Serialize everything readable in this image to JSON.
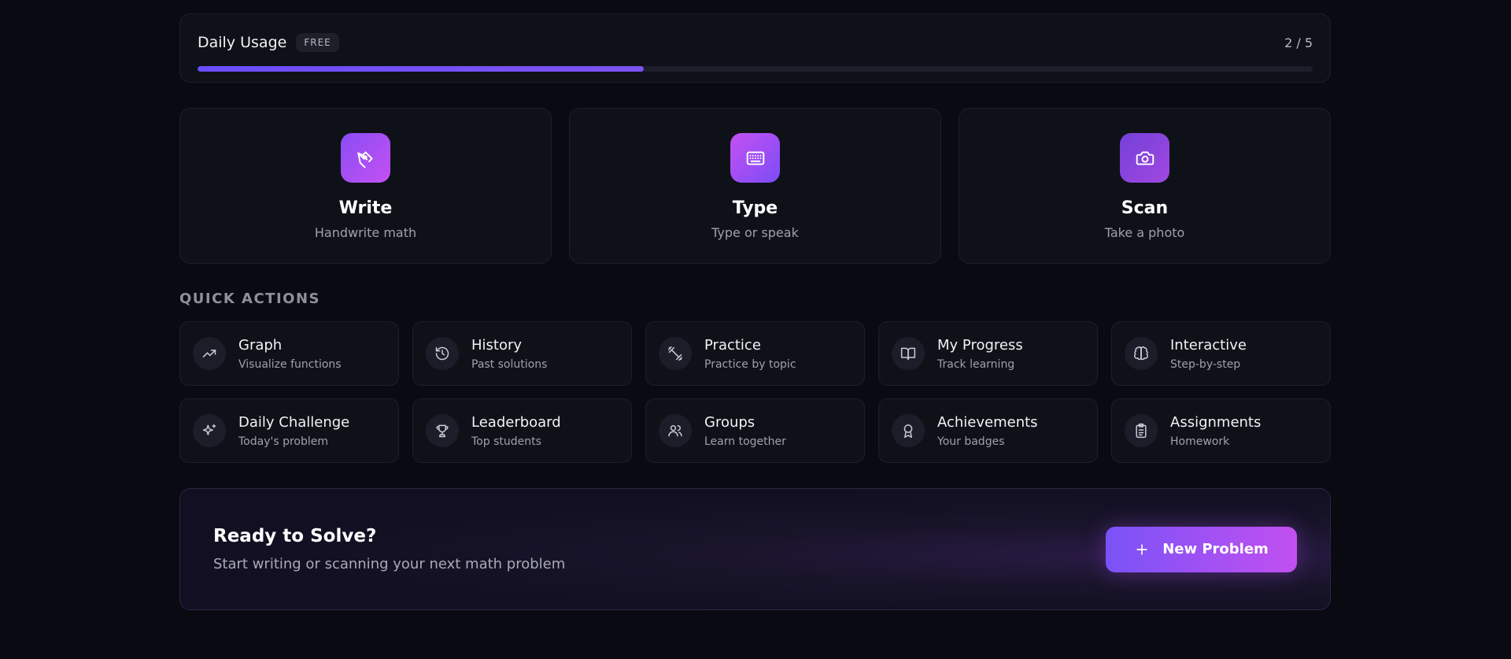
{
  "usage": {
    "title": "Daily Usage",
    "badge": "FREE",
    "count": "2 / 5",
    "used": 2,
    "limit": 5
  },
  "modes": [
    {
      "title": "Write",
      "subtitle": "Handwrite math",
      "icon": "pen-icon"
    },
    {
      "title": "Type",
      "subtitle": "Type or speak",
      "icon": "keyboard-icon"
    },
    {
      "title": "Scan",
      "subtitle": "Take a photo",
      "icon": "camera-icon"
    }
  ],
  "quick_actions": {
    "heading": "QUICK ACTIONS",
    "items": [
      {
        "title": "Graph",
        "subtitle": "Visualize functions",
        "icon": "trending-up-icon"
      },
      {
        "title": "History",
        "subtitle": "Past solutions",
        "icon": "history-icon"
      },
      {
        "title": "Practice",
        "subtitle": "Practice by topic",
        "icon": "dumbbell-icon"
      },
      {
        "title": "My Progress",
        "subtitle": "Track learning",
        "icon": "book-open-icon"
      },
      {
        "title": "Interactive",
        "subtitle": "Step-by-step",
        "icon": "brain-icon"
      },
      {
        "title": "Daily Challenge",
        "subtitle": "Today's problem",
        "icon": "sparkles-icon"
      },
      {
        "title": "Leaderboard",
        "subtitle": "Top students",
        "icon": "trophy-icon"
      },
      {
        "title": "Groups",
        "subtitle": "Learn together",
        "icon": "users-icon"
      },
      {
        "title": "Achievements",
        "subtitle": "Your badges",
        "icon": "award-icon"
      },
      {
        "title": "Assignments",
        "subtitle": "Homework",
        "icon": "clipboard-icon"
      }
    ]
  },
  "cta": {
    "title": "Ready to Solve?",
    "subtitle": "Start writing or scanning your next math problem",
    "button_label": "New Problem"
  },
  "colors": {
    "background": "#0a0a12",
    "card": "#0f1119",
    "accent": "#7a52f7",
    "accent2": "#c250f0"
  }
}
